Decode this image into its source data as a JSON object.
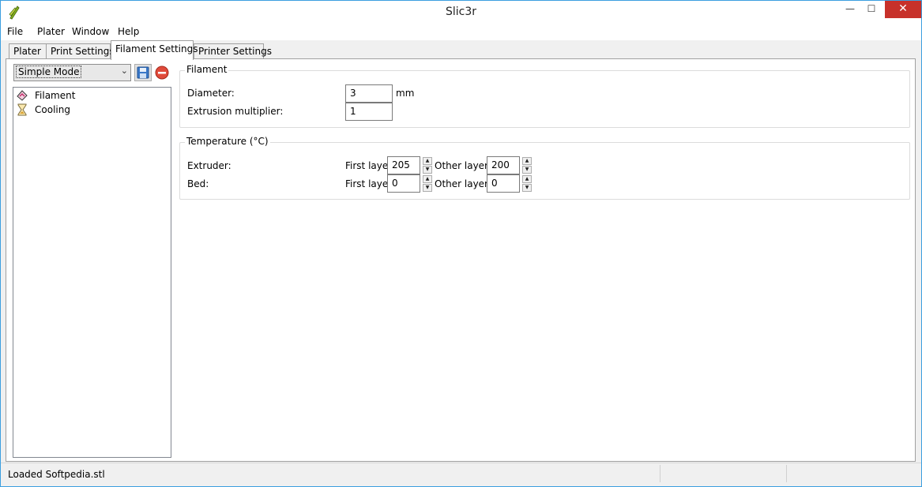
{
  "window": {
    "title": "Slic3r",
    "min_glyph": "—",
    "max_glyph": "☐",
    "close_glyph": "✕"
  },
  "menu": {
    "items": [
      "File",
      "Plater",
      "Window",
      "Help"
    ]
  },
  "tabs": [
    {
      "label": "Plater",
      "active": false
    },
    {
      "label": "Print Settings",
      "active": false
    },
    {
      "label": "Filament Settings",
      "active": true
    },
    {
      "label": "Printer Settings",
      "active": false
    }
  ],
  "mode_select": {
    "value": "Simple Mode"
  },
  "icons": {
    "save": "save-icon",
    "delete": "delete-icon",
    "filament": "filament-icon",
    "cooling": "hourglass-icon"
  },
  "tree": {
    "items": [
      {
        "label": "Filament",
        "selected": true
      },
      {
        "label": "Cooling",
        "selected": false
      }
    ]
  },
  "filament_group": {
    "title": "Filament",
    "diameter_label": "Diameter:",
    "diameter_value": "3",
    "diameter_unit": "mm",
    "multiplier_label": "Extrusion multiplier:",
    "multiplier_value": "1"
  },
  "temperature_group": {
    "title": "Temperature (°C)",
    "extruder_label": "Extruder:",
    "bed_label": "Bed:",
    "first_layer_label": "First layer:",
    "other_layers_label": "Other layers:",
    "extruder_first": "205",
    "extruder_other": "200",
    "bed_first": "0",
    "bed_other": "0"
  },
  "status": {
    "text": "Loaded Softpedia.stl"
  },
  "colors": {
    "accent": "#3c9fe0",
    "close": "#c7312a"
  }
}
